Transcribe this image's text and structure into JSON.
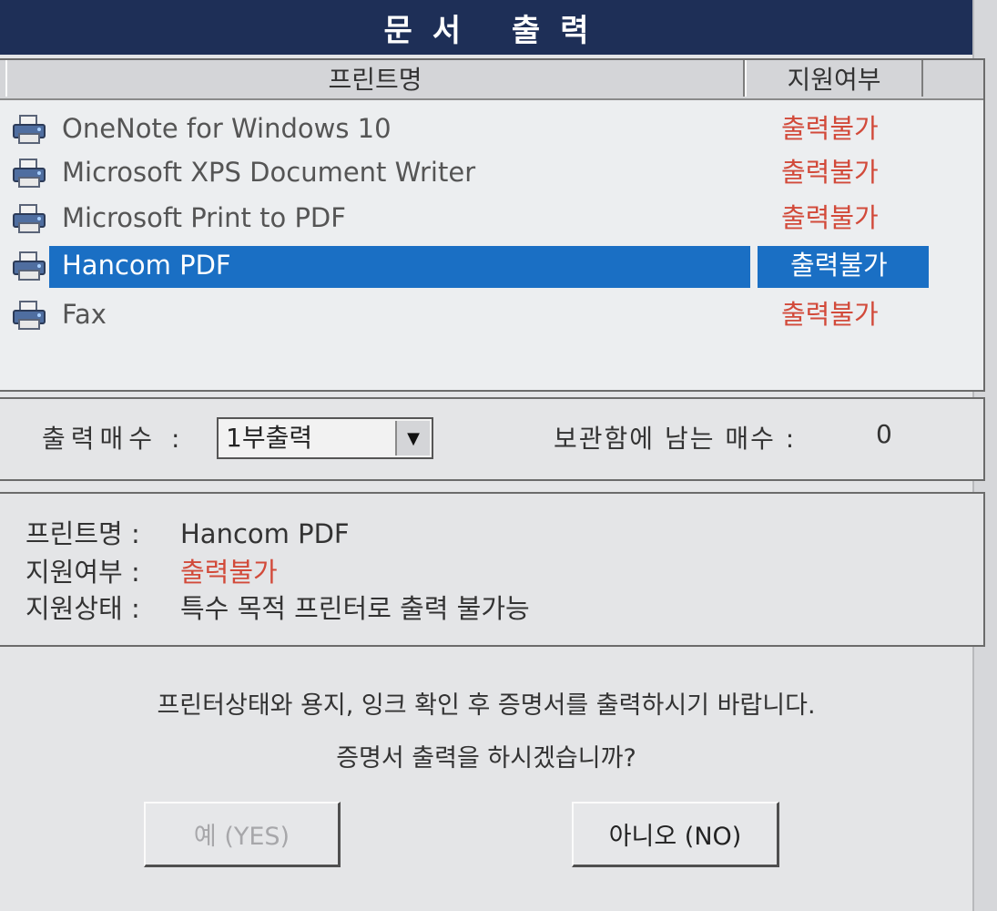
{
  "window": {
    "title": "문서 출력"
  },
  "columns": {
    "printer_name": "프린트명",
    "support": "지원여부"
  },
  "printers": [
    {
      "name": "OneNote for Windows 10",
      "status": "출력불가",
      "selected": false
    },
    {
      "name": "Microsoft XPS Document Writer",
      "status": "출력불가",
      "selected": false
    },
    {
      "name": "Microsoft Print to PDF",
      "status": "출력불가",
      "selected": false
    },
    {
      "name": "Hancom PDF",
      "status": "출력불가",
      "selected": true
    },
    {
      "name": "Fax",
      "status": "출력불가",
      "selected": false
    }
  ],
  "copies": {
    "label": "출력매수 :",
    "selected": "1부출력",
    "remaining_label": "보관함에 남는 매수 :",
    "remaining_value": "0"
  },
  "info": {
    "name_label": "프린트명 :",
    "name_value": "Hancom PDF",
    "support_label": "지원여부 :",
    "support_value": "출력불가",
    "state_label": "지원상태 :",
    "state_value": "특수 목적 프린터로 출력 불가능"
  },
  "message": {
    "line1": "프린터상태와 용지, 잉크 확인 후 증명서를 출력하시기 바랍니다.",
    "line2": "증명서 출력을 하시겠습니까?"
  },
  "buttons": {
    "yes": "예 (YES)",
    "no": "아니오 (NO)"
  },
  "colors": {
    "title_bg": "#1e2f57",
    "selection": "#1a6fc4",
    "error_text": "#d24a3a"
  },
  "icons": {
    "printer": "printer-icon",
    "dropdown": "dropdown-arrow-icon"
  }
}
